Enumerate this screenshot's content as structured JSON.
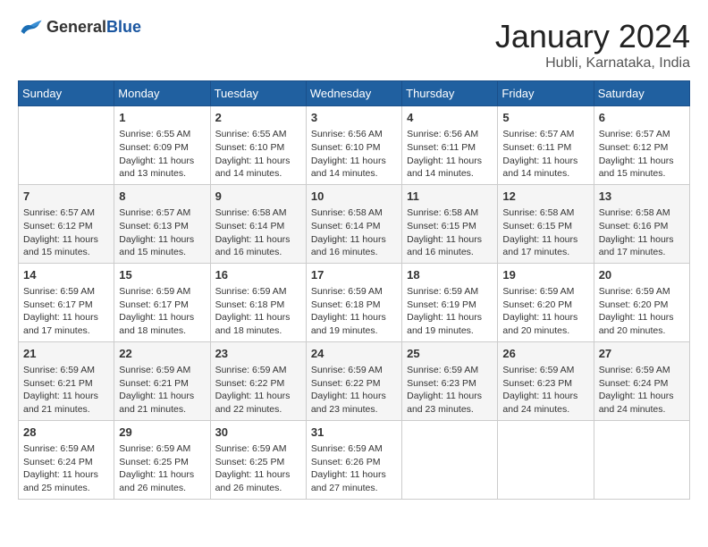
{
  "header": {
    "logo_general": "General",
    "logo_blue": "Blue",
    "title": "January 2024",
    "location": "Hubli, Karnataka, India"
  },
  "columns": [
    "Sunday",
    "Monday",
    "Tuesday",
    "Wednesday",
    "Thursday",
    "Friday",
    "Saturday"
  ],
  "weeks": [
    [
      {
        "day": "",
        "content": ""
      },
      {
        "day": "1",
        "content": "Sunrise: 6:55 AM\nSunset: 6:09 PM\nDaylight: 11 hours\nand 13 minutes."
      },
      {
        "day": "2",
        "content": "Sunrise: 6:55 AM\nSunset: 6:10 PM\nDaylight: 11 hours\nand 14 minutes."
      },
      {
        "day": "3",
        "content": "Sunrise: 6:56 AM\nSunset: 6:10 PM\nDaylight: 11 hours\nand 14 minutes."
      },
      {
        "day": "4",
        "content": "Sunrise: 6:56 AM\nSunset: 6:11 PM\nDaylight: 11 hours\nand 14 minutes."
      },
      {
        "day": "5",
        "content": "Sunrise: 6:57 AM\nSunset: 6:11 PM\nDaylight: 11 hours\nand 14 minutes."
      },
      {
        "day": "6",
        "content": "Sunrise: 6:57 AM\nSunset: 6:12 PM\nDaylight: 11 hours\nand 15 minutes."
      }
    ],
    [
      {
        "day": "7",
        "content": "Sunrise: 6:57 AM\nSunset: 6:12 PM\nDaylight: 11 hours\nand 15 minutes."
      },
      {
        "day": "8",
        "content": "Sunrise: 6:57 AM\nSunset: 6:13 PM\nDaylight: 11 hours\nand 15 minutes."
      },
      {
        "day": "9",
        "content": "Sunrise: 6:58 AM\nSunset: 6:14 PM\nDaylight: 11 hours\nand 16 minutes."
      },
      {
        "day": "10",
        "content": "Sunrise: 6:58 AM\nSunset: 6:14 PM\nDaylight: 11 hours\nand 16 minutes."
      },
      {
        "day": "11",
        "content": "Sunrise: 6:58 AM\nSunset: 6:15 PM\nDaylight: 11 hours\nand 16 minutes."
      },
      {
        "day": "12",
        "content": "Sunrise: 6:58 AM\nSunset: 6:15 PM\nDaylight: 11 hours\nand 17 minutes."
      },
      {
        "day": "13",
        "content": "Sunrise: 6:58 AM\nSunset: 6:16 PM\nDaylight: 11 hours\nand 17 minutes."
      }
    ],
    [
      {
        "day": "14",
        "content": "Sunrise: 6:59 AM\nSunset: 6:17 PM\nDaylight: 11 hours\nand 17 minutes."
      },
      {
        "day": "15",
        "content": "Sunrise: 6:59 AM\nSunset: 6:17 PM\nDaylight: 11 hours\nand 18 minutes."
      },
      {
        "day": "16",
        "content": "Sunrise: 6:59 AM\nSunset: 6:18 PM\nDaylight: 11 hours\nand 18 minutes."
      },
      {
        "day": "17",
        "content": "Sunrise: 6:59 AM\nSunset: 6:18 PM\nDaylight: 11 hours\nand 19 minutes."
      },
      {
        "day": "18",
        "content": "Sunrise: 6:59 AM\nSunset: 6:19 PM\nDaylight: 11 hours\nand 19 minutes."
      },
      {
        "day": "19",
        "content": "Sunrise: 6:59 AM\nSunset: 6:20 PM\nDaylight: 11 hours\nand 20 minutes."
      },
      {
        "day": "20",
        "content": "Sunrise: 6:59 AM\nSunset: 6:20 PM\nDaylight: 11 hours\nand 20 minutes."
      }
    ],
    [
      {
        "day": "21",
        "content": "Sunrise: 6:59 AM\nSunset: 6:21 PM\nDaylight: 11 hours\nand 21 minutes."
      },
      {
        "day": "22",
        "content": "Sunrise: 6:59 AM\nSunset: 6:21 PM\nDaylight: 11 hours\nand 21 minutes."
      },
      {
        "day": "23",
        "content": "Sunrise: 6:59 AM\nSunset: 6:22 PM\nDaylight: 11 hours\nand 22 minutes."
      },
      {
        "day": "24",
        "content": "Sunrise: 6:59 AM\nSunset: 6:22 PM\nDaylight: 11 hours\nand 23 minutes."
      },
      {
        "day": "25",
        "content": "Sunrise: 6:59 AM\nSunset: 6:23 PM\nDaylight: 11 hours\nand 23 minutes."
      },
      {
        "day": "26",
        "content": "Sunrise: 6:59 AM\nSunset: 6:23 PM\nDaylight: 11 hours\nand 24 minutes."
      },
      {
        "day": "27",
        "content": "Sunrise: 6:59 AM\nSunset: 6:24 PM\nDaylight: 11 hours\nand 24 minutes."
      }
    ],
    [
      {
        "day": "28",
        "content": "Sunrise: 6:59 AM\nSunset: 6:24 PM\nDaylight: 11 hours\nand 25 minutes."
      },
      {
        "day": "29",
        "content": "Sunrise: 6:59 AM\nSunset: 6:25 PM\nDaylight: 11 hours\nand 26 minutes."
      },
      {
        "day": "30",
        "content": "Sunrise: 6:59 AM\nSunset: 6:25 PM\nDaylight: 11 hours\nand 26 minutes."
      },
      {
        "day": "31",
        "content": "Sunrise: 6:59 AM\nSunset: 6:26 PM\nDaylight: 11 hours\nand 27 minutes."
      },
      {
        "day": "",
        "content": ""
      },
      {
        "day": "",
        "content": ""
      },
      {
        "day": "",
        "content": ""
      }
    ]
  ]
}
